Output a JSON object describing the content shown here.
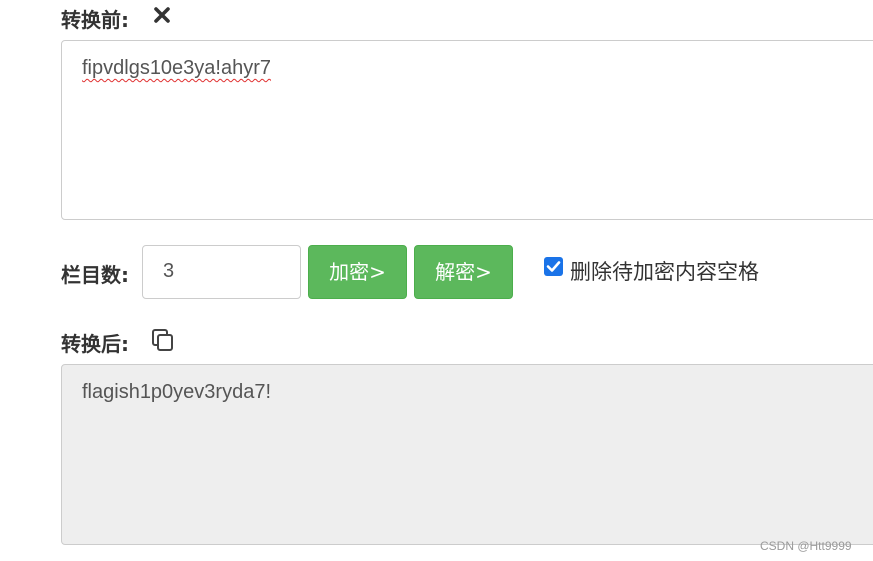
{
  "before": {
    "label": "转换前:",
    "clear_icon": "close-icon",
    "input_value": "fipvdlgs10e3ya!ahyr7"
  },
  "controls": {
    "columns_label": "栏目数:",
    "columns_value": "3",
    "encrypt_label": "加密>",
    "decrypt_label": "解密>",
    "remove_spaces_checked": true,
    "remove_spaces_label": "删除待加密内容空格",
    "button_color": "#5cb85c",
    "checkbox_color": "#1a73e8"
  },
  "after": {
    "label": "转换后:",
    "copy_icon": "copy-icon",
    "output_value": "flagish1p0yev3ryda7!"
  },
  "watermark": "CSDN @Htt9999"
}
